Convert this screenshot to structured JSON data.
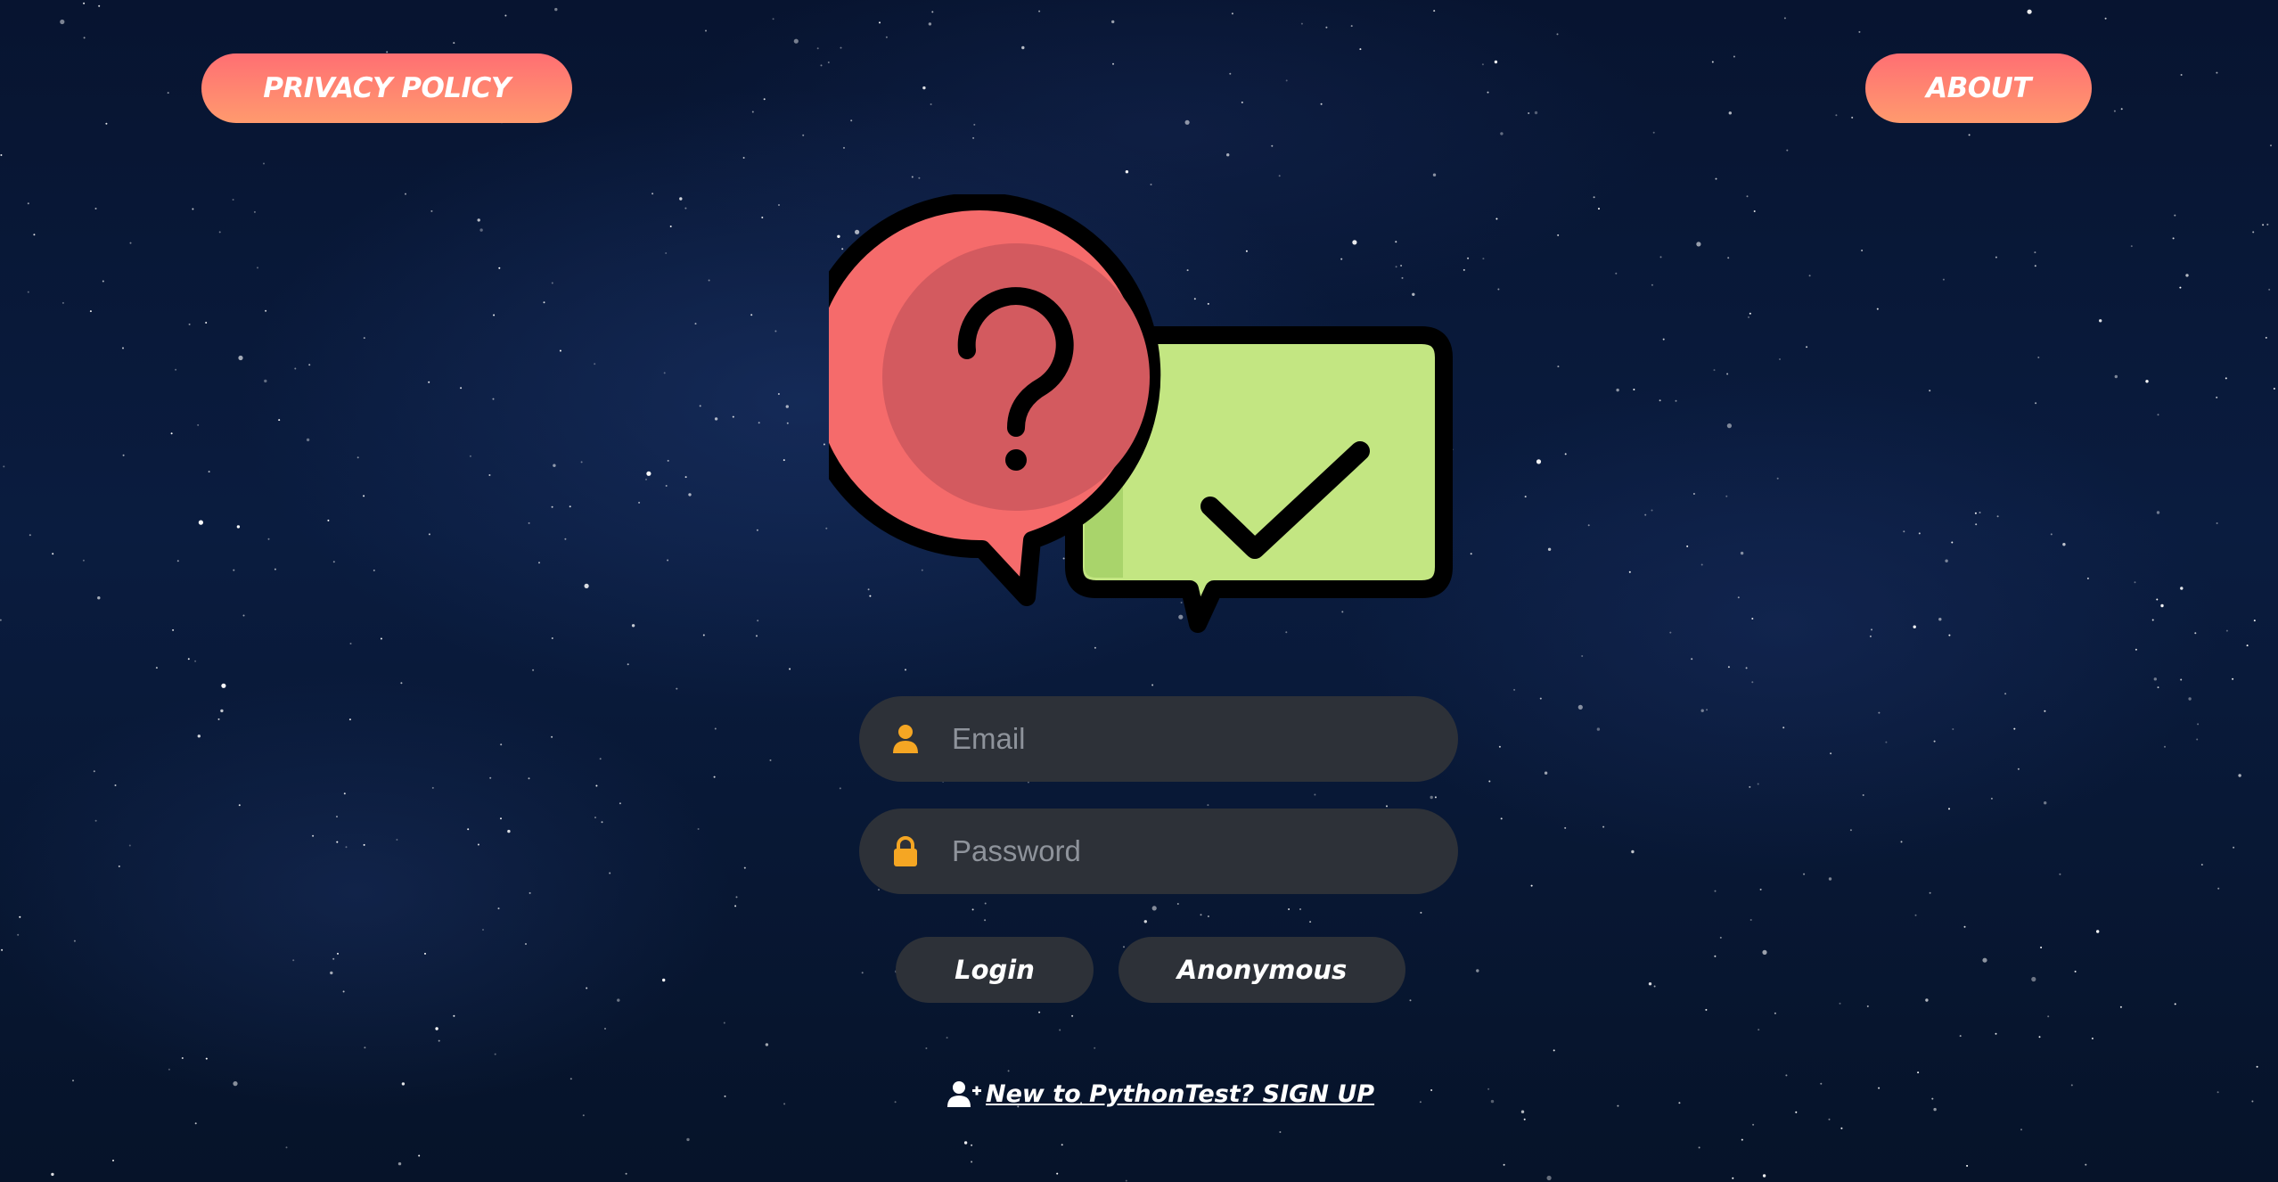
{
  "header": {
    "privacy_label": "PRIVACY POLICY",
    "about_label": "ABOUT"
  },
  "logo": {
    "icon": "question-answer-chat-icon",
    "colors": {
      "question_bubble": "#f56b6b",
      "question_bubble_inner": "#d35a5f",
      "answer_bubble": "#c3e682",
      "answer_bubble_shade": "#a9d46b",
      "outline": "#000000"
    }
  },
  "login_form": {
    "email": {
      "placeholder": "Email",
      "value": "",
      "icon": "user-icon"
    },
    "password": {
      "placeholder": "Password",
      "value": "",
      "icon": "lock-icon"
    },
    "login_label": "Login",
    "anonymous_label": "Anonymous"
  },
  "signup": {
    "label": "New to PythonTest? SIGN UP",
    "icon": "user-plus-icon"
  },
  "colors": {
    "background": "#0a1c3f",
    "accent_gradient_start": "#ff6f73",
    "accent_gradient_end": "#ff9a6e",
    "field_bg": "#2d3138",
    "icon_orange": "#f5a623"
  }
}
